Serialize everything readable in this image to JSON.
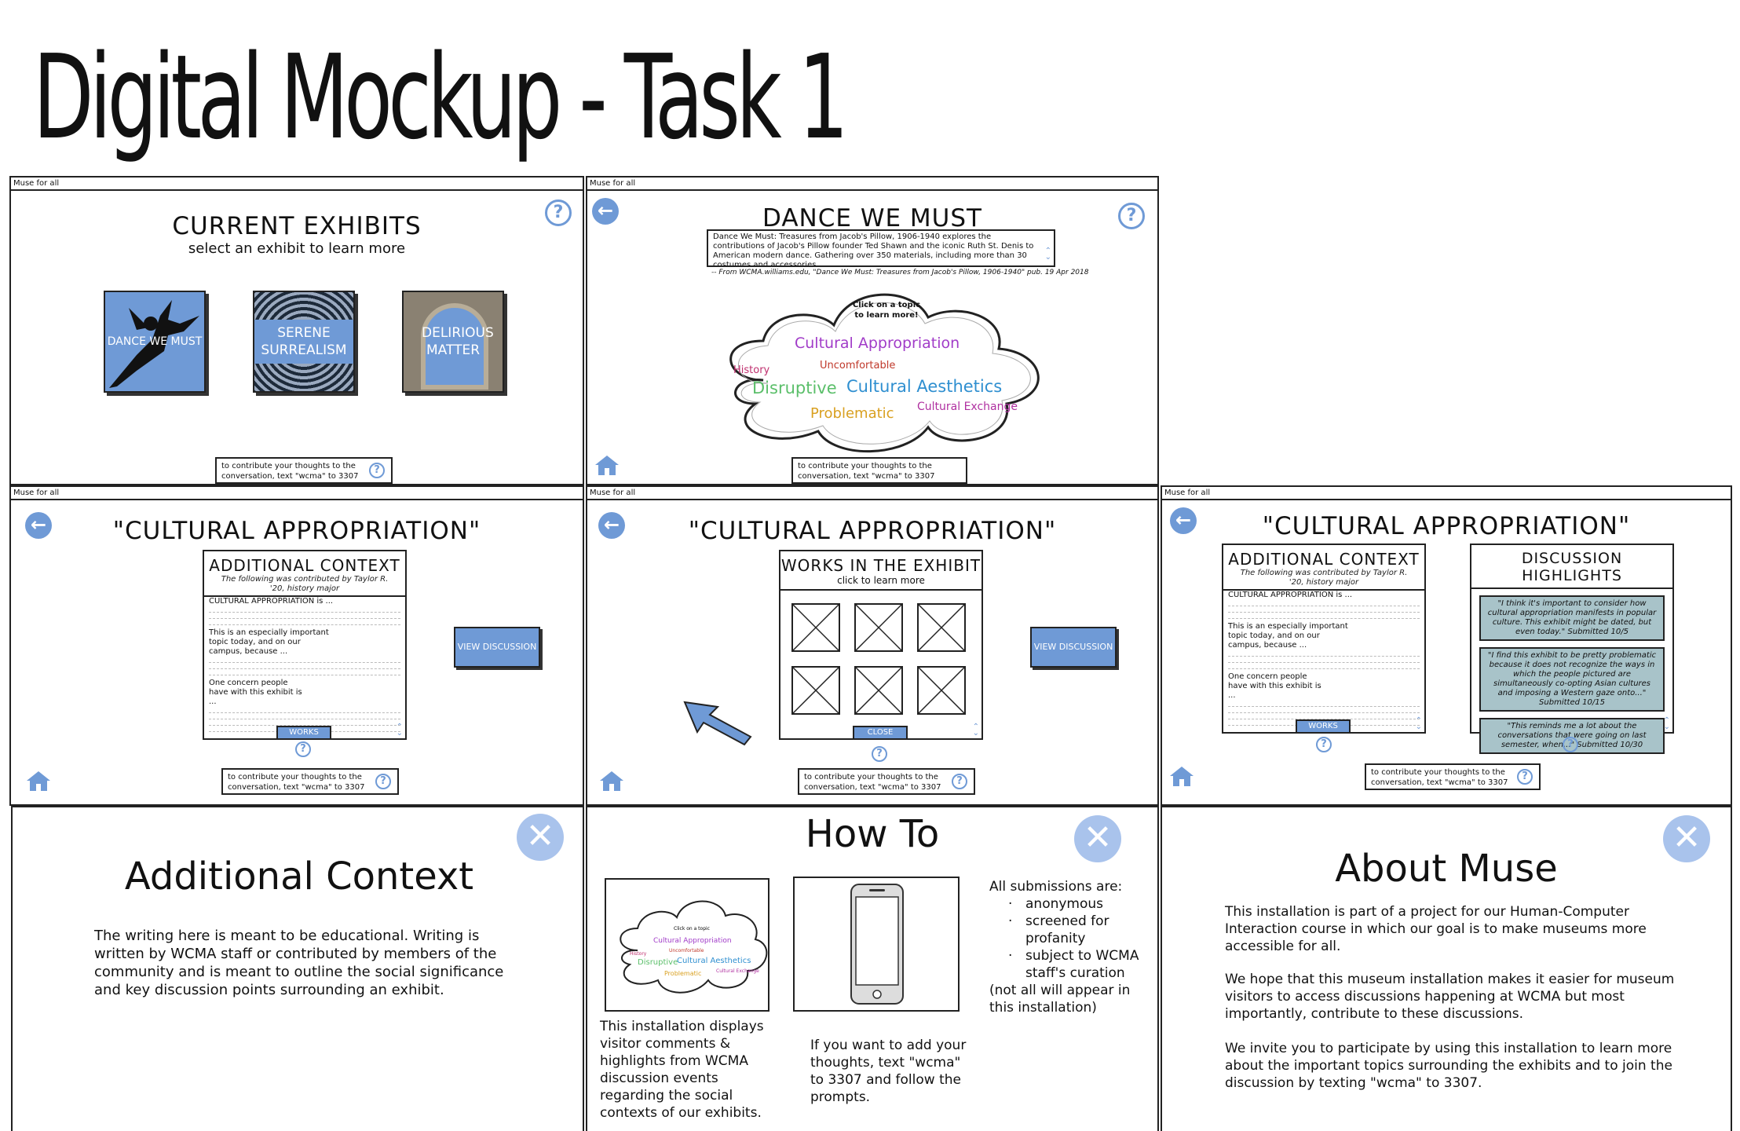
{
  "page": {
    "title": "Digital Mockup - Task 1"
  },
  "app_name": "Muse for all",
  "contribute_text": "to contribute your thoughts to the conversation, text \"wcma\" to 3307",
  "icons": {
    "help": "?",
    "back": "←",
    "close": "✕",
    "home": "home-icon"
  },
  "colors": {
    "accent": "#6f9ad6",
    "accent_light": "#a9c3ec",
    "highlight_bg": "#a8c3c9"
  },
  "current_exhibits": {
    "title": "CURRENT EXHIBITS",
    "subtitle": "select an exhibit to learn more",
    "tiles": [
      {
        "label": "DANCE WE MUST"
      },
      {
        "label": "SERENE SURREALISM"
      },
      {
        "label": "DELIRIOUS MATTER"
      }
    ]
  },
  "dance": {
    "title": "DANCE WE MUST",
    "description": "Dance We Must: Treasures from Jacob's Pillow, 1906-1940 explores the contributions of Jacob's Pillow founder Ted Shawn and the iconic Ruth St. Denis to American modern dance. Gathering over 350 materials, including more than 30 costumes and accessories",
    "citation": "-- From WCMA.williams.edu, \"Dance We Must: Treasures from Jacob's Pillow, 1906-1940\" pub. 19 Apr 2018",
    "cloud_prompt": "Click on a topic to learn more!",
    "topics": [
      {
        "label": "Cultural Appropriation",
        "color": "#a13cc8"
      },
      {
        "label": "Uncomfortable",
        "color": "#c0392b"
      },
      {
        "label": "History",
        "color": "#c0306f"
      },
      {
        "label": "Disruptive",
        "color": "#5bbf6a"
      },
      {
        "label": "Cultural Aesthetics",
        "color": "#2f8fd0"
      },
      {
        "label": "Problematic",
        "color": "#d9a020"
      },
      {
        "label": "Cultural Exchange",
        "color": "#b030a0"
      }
    ]
  },
  "cultural": {
    "title": "\"CULTURAL APPROPRIATION\"",
    "context": {
      "title": "ADDITIONAL CONTEXT",
      "contributor": "The following was contributed by Taylor R. '20, history major",
      "line1": "CULTURAL APPROPRIATION is ...",
      "line2": "This is an especially important topic today, and on our campus, because ...",
      "line3": "One concern people have with this exhibit is ...",
      "works_button": "WORKS"
    },
    "view_discussion": "VIEW DISCUSSION",
    "works": {
      "title": "WORKS IN THE EXHIBIT",
      "subtitle": "click to learn more",
      "close_button": "CLOSE"
    },
    "discussion": {
      "title": "DISCUSSION HIGHLIGHTS",
      "highlights": [
        "\"I think it's important to consider how cultural appropriation manifests in popular culture. This exhibit might be dated, but even today.\" Submitted 10/5",
        "\"I find this exhibit to be pretty problematic because it does not recognize the ways in which the people pictured are simultaneously co-opting Asian cultures and imposing a Western gaze onto...\" Submitted 10/15",
        "\"This reminds me a lot about the conversations that were going on last semester, when...\" Submitted 10/30"
      ]
    }
  },
  "additional_context_info": {
    "title": "Additional Context",
    "body": "The writing here is meant to be educational. Writing is written by WCMA staff or contributed by members of the community and is meant to outline the social significance and key discussion points surrounding an exhibit."
  },
  "how_to": {
    "title": "How To",
    "col1": "This installation displays visitor comments & highlights from WCMA discussion events regarding the social contexts of our exhibits.",
    "col2": "If you want to add your thoughts, text \"wcma\" to 3307 and follow the prompts.",
    "submissions_heading": "All submissions are:",
    "submissions": [
      "anonymous",
      "screened for profanity",
      "subject to WCMA staff's curation"
    ],
    "footnote": "(not all will appear in this installation)"
  },
  "about": {
    "title": "About Muse",
    "p1": "This installation is part of a project for our Human-Computer Interaction course in which our goal is to make museums more accessible for all.",
    "p2": "We hope that this museum installation makes it easier for museum visitors to access discussions happening at WCMA but most importantly, contribute to these discussions.",
    "p3": "We invite you to participate by using this installation to learn more about the important topics surrounding the exhibits and to join the discussion by texting \"wcma\" to 3307."
  }
}
